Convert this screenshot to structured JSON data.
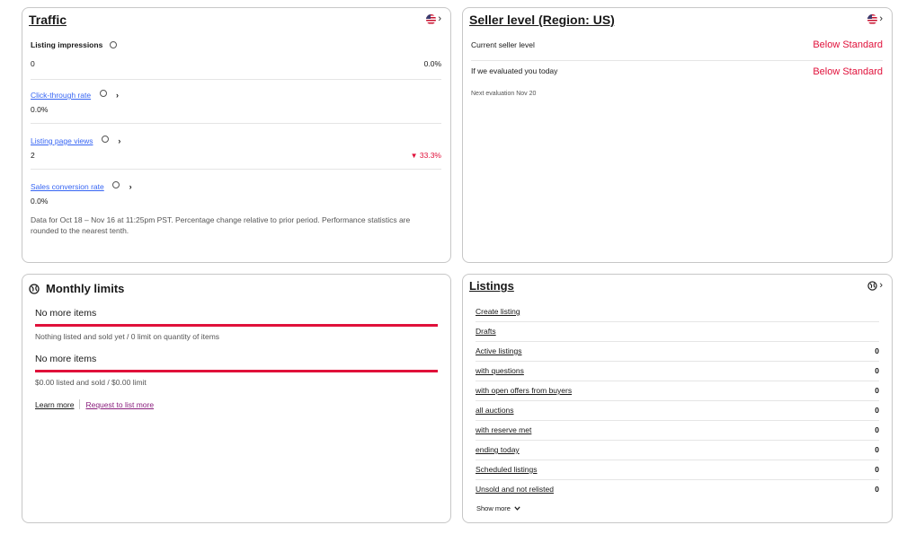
{
  "traffic": {
    "title": "Traffic",
    "impressions_label": "Listing impressions",
    "impressions_value": "0",
    "impressions_change": "0.0%",
    "ctr_label": "Click-through rate",
    "ctr_value": "0.0%",
    "views_label": "Listing page views",
    "views_value": "2",
    "views_change": "33.3%",
    "conversion_label": "Sales conversion rate",
    "conversion_value": "0.0%",
    "note": "Data for Oct 18 – Nov 16 at 11:25pm PST. Percentage change relative to prior period. Performance statistics are rounded to the nearest tenth."
  },
  "seller": {
    "title": "Seller level (Region: US)",
    "current_label": "Current seller level",
    "current_value": "Below Standard",
    "eval_label": "If we evaluated you today",
    "eval_value": "Below Standard",
    "next_eval": "Next evaluation Nov 20"
  },
  "limits": {
    "title": "Monthly limits",
    "items_heading": "No more items",
    "items_text": "Nothing listed and sold yet /  0 limit on quantity of items",
    "amount_heading": "No more items",
    "amount_text": "$0.00 listed and sold /  $0.00 limit",
    "learn_more": "Learn more",
    "request_more": "Request to list more"
  },
  "listings": {
    "title": "Listings",
    "rows": [
      {
        "label": "Create listing",
        "value": ""
      },
      {
        "label": "Drafts",
        "value": ""
      },
      {
        "label": "Active listings",
        "value": "0"
      },
      {
        "label": "with questions",
        "value": "0"
      },
      {
        "label": "with open offers from buyers",
        "value": "0"
      },
      {
        "label": "all auctions",
        "value": "0"
      },
      {
        "label": "with reserve met",
        "value": "0"
      },
      {
        "label": "ending today",
        "value": "0"
      },
      {
        "label": "Scheduled listings",
        "value": "0"
      },
      {
        "label": "Unsold and not relisted",
        "value": "0"
      }
    ],
    "show_more": "Show more"
  },
  "colors": {
    "accent_red": "#e0103a",
    "link_blue": "#3665f3",
    "link_purple": "#8a1f7d"
  },
  "icons": [
    "us-flag-icon",
    "chevron-right-icon",
    "info-icon",
    "globe-icon",
    "chevron-down-icon",
    "down-triangle-icon"
  ]
}
